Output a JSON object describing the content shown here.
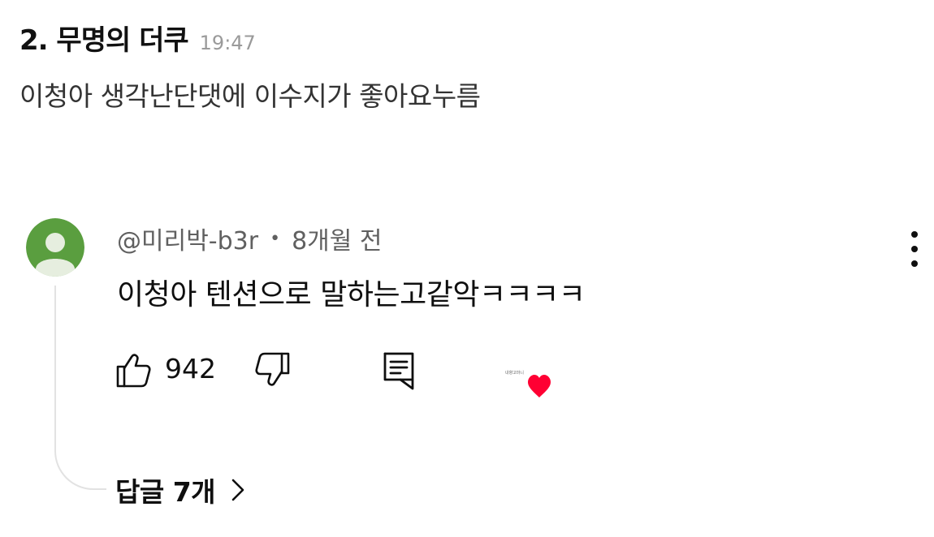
{
  "post": {
    "title": "2. 무명의 더쿠",
    "time": "19:47",
    "body": "이청아 생각난단댓에 이수지가 좋아요누름"
  },
  "comment": {
    "author": "@미리박-b3r",
    "separator": "•",
    "age": "8개월 전",
    "text": "이청아 텐션으로 말하는고같악ㅋㅋㅋㅋ",
    "like_count": "942",
    "avatar_color": "#5a9e3f",
    "heart_color": "#ff0033",
    "heart_badge_text": "내향고마니"
  },
  "replies": {
    "label": "답글 7개"
  },
  "icons": {
    "avatar": "default-user-avatar-icon",
    "like": "thumbs-up-icon",
    "dislike": "thumbs-down-icon",
    "reply": "comment-reply-icon",
    "menu": "more-vertical-icon",
    "heart": "creator-heart-icon",
    "chevron": "chevron-right-icon"
  }
}
